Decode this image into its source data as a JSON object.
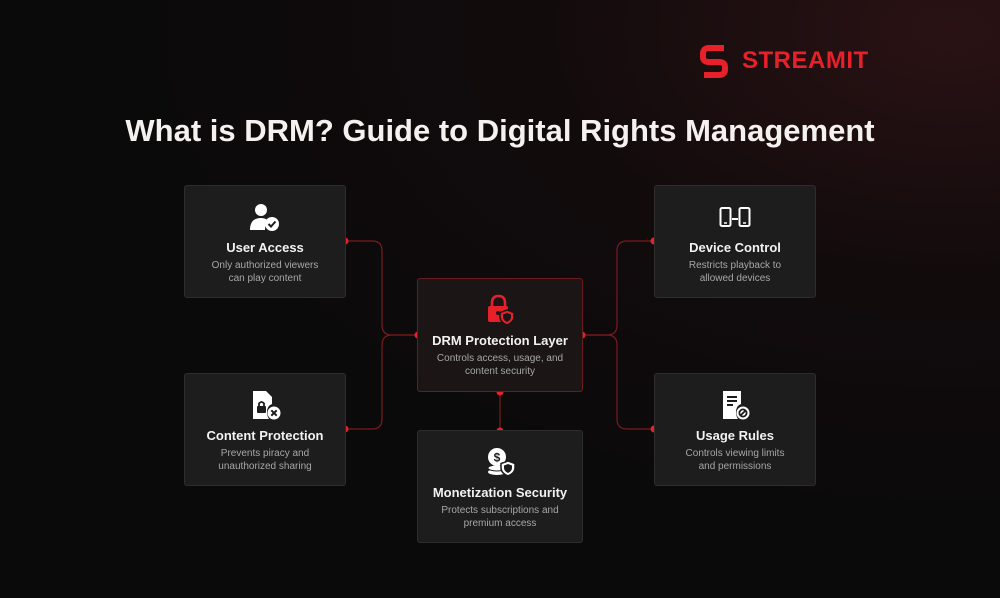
{
  "brand": {
    "name": "STREAMIT",
    "accent": "#e8202a"
  },
  "title": "What is DRM? Guide to Digital Rights Management",
  "nodes": {
    "user_access": {
      "title": "User Access",
      "desc1": "Only authorized viewers",
      "desc2": "can play content",
      "icon": "user-check-icon"
    },
    "content_protection": {
      "title": "Content Protection",
      "desc1": "Prevents piracy and",
      "desc2": "unauthorized sharing",
      "icon": "file-lock-icon"
    },
    "drm_layer": {
      "title": "DRM Protection Layer",
      "desc1": "Controls access, usage, and",
      "desc2": "content security",
      "icon": "lock-shield-icon"
    },
    "monetization": {
      "title": "Monetization Security",
      "desc1": "Protects subscriptions and",
      "desc2": "premium access",
      "icon": "coins-shield-icon"
    },
    "device_control": {
      "title": "Device Control",
      "desc1": "Restricts playback to",
      "desc2": "allowed devices",
      "icon": "devices-icon"
    },
    "usage_rules": {
      "title": "Usage Rules",
      "desc1": "Controls viewing limits",
      "desc2": "and permissions",
      "icon": "document-block-icon"
    }
  }
}
